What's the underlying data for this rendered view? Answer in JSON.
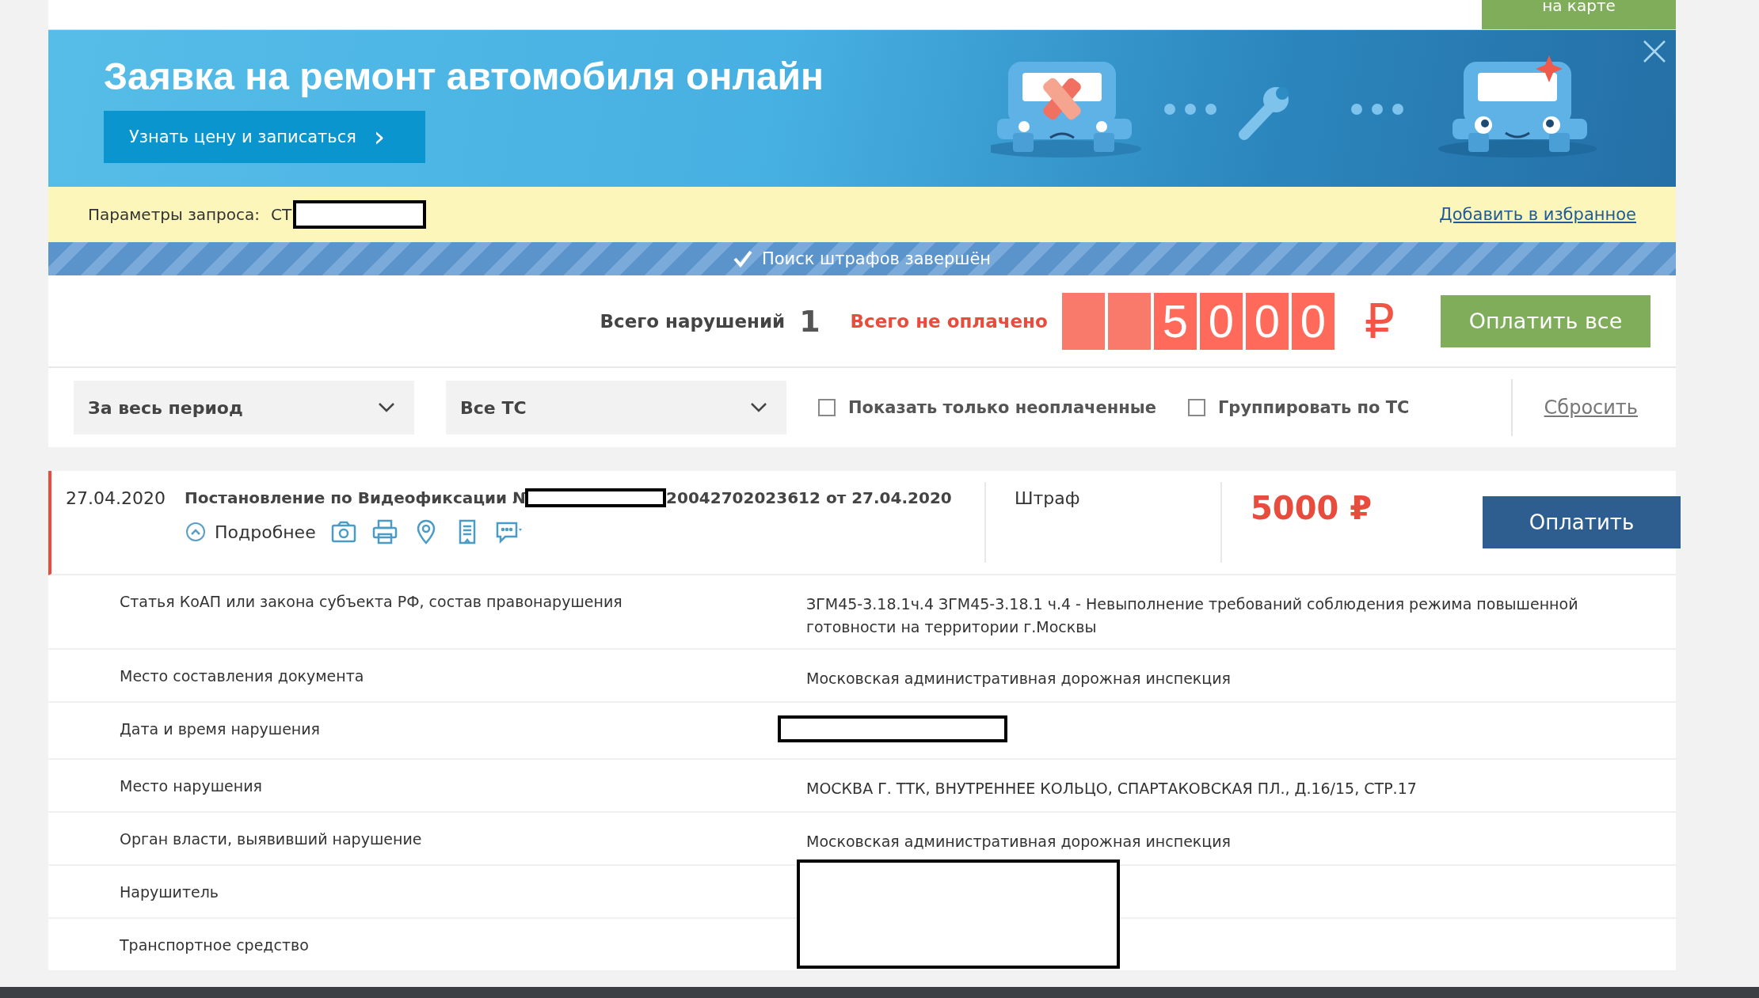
{
  "top_bar": {
    "map_button": "на карте"
  },
  "banner": {
    "title": "Заявка на ремонт автомобиля онлайн",
    "button": "Узнать цену и записаться",
    "button_icon": "›"
  },
  "request": {
    "label": "Параметры запроса:",
    "value": "СТ",
    "add_favorite": "Добавить в избранное"
  },
  "status": {
    "text": "Поиск штрафов завершён",
    "done": true
  },
  "totals": {
    "violations_label": "Всего нарушений",
    "violations_count": "1",
    "unpaid_label": "Всего не оплачено",
    "digit_cells": [
      {
        "kind": "blank"
      },
      {
        "kind": "blank"
      },
      {
        "kind": "digit",
        "text": "5"
      },
      {
        "kind": "digit",
        "text": "0"
      },
      {
        "kind": "digit",
        "text": "0"
      },
      {
        "kind": "digit",
        "text": "0"
      }
    ],
    "currency": "₽",
    "pay_all": "Оплатить все"
  },
  "filters": {
    "period": "За весь период",
    "vehicle": "Все ТС",
    "checkboxes": [
      {
        "label": "Показать только неоплаченные",
        "checked": false
      },
      {
        "label": "Группировать по ТС",
        "checked": false
      }
    ],
    "reset": "Сбросить"
  },
  "fines": [
    {
      "date": "27.04.2020",
      "title_start": "Постановление по Видеофиксации №",
      "title_end": "20042702023612 от 27.04.2020",
      "more": "Подробнее",
      "expanded": true,
      "type": "Штраф",
      "amount": "5000 ₽",
      "pay": "Оплатить",
      "paid": false,
      "details": [
        {
          "label": "Статья КоАП или закона субъекта РФ, состав правонарушения",
          "value": "ЗГМ45-3.18.1ч.4 ЗГМ45-3.18.1 ч.4 - Невыполнение требований соблюдения режима повышенной готовности на территории г.Москвы"
        },
        {
          "label": "Место составления документа",
          "value": "Московская административная дорожная инспекция"
        },
        {
          "label": "Дата и время нарушения",
          "kind": "redacted"
        },
        {
          "label": "Место нарушения",
          "value": "МОСКВА Г. ТТК, ВНУТРЕННЕЕ КОЛЬЦО, СПАРТАКОВСКАЯ ПЛ., Д.16/15, СТР.17"
        },
        {
          "label": "Орган власти, выявивший нарушение",
          "value": "Московская административная дорожная инспекция"
        },
        {
          "label": "Нарушитель",
          "kind": "redacted-tall"
        },
        {
          "label": "Транспортное средство",
          "kind": "empty"
        }
      ]
    }
  ]
}
